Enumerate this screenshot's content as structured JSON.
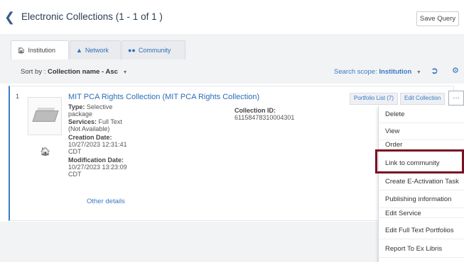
{
  "header": {
    "title": "Electronic Collections (1 - 1 of 1 )",
    "save_query": "Save Query"
  },
  "tabs": [
    {
      "label": "Institution",
      "icon": "home-icon",
      "active": true
    },
    {
      "label": "Network",
      "icon": "network-icon",
      "active": false
    },
    {
      "label": "Community",
      "icon": "community-icon",
      "active": false
    }
  ],
  "toolbar": {
    "sort_prefix": "Sort by :",
    "sort_value": "Collection name - Asc",
    "scope_prefix": "Search scope:",
    "scope_value": "Institution"
  },
  "record": {
    "number": "1",
    "title": "MIT PCA Rights Collection (MIT PCA Rights Collection)",
    "type_label": "Type:",
    "type_value": "Selective",
    "type_value2": "package",
    "services_label": "Services:",
    "services_value": "Full Text",
    "services_value2": "(Not Available)",
    "creation_label": "Creation Date:",
    "creation_value": "10/27/2023 12:31:41",
    "creation_tz": "CDT",
    "modification_label": "Modification Date:",
    "modification_value": "10/27/2023 13:23:09",
    "modification_tz": "CDT",
    "collection_id_label": "Collection ID:",
    "collection_id_value": "61158478310004301",
    "other_details": "Other details",
    "portfolio_list": "Portfolio List (7)",
    "edit_collection": "Edit Collection",
    "more": "···"
  },
  "menu": {
    "items": [
      "Delete",
      "View",
      "Order",
      "Link to community",
      "Create E-Activation Task",
      "Publishing information",
      "Edit Service",
      "Edit Full Text Portfolios",
      "Report To Ex Libris"
    ]
  },
  "colors": {
    "accent": "#3978c5",
    "highlight": "#7a0f22"
  }
}
